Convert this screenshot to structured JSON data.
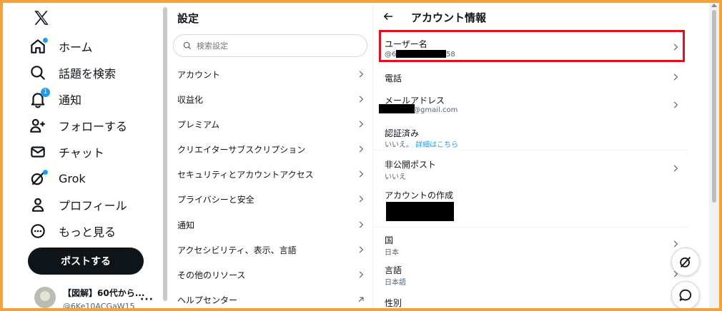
{
  "nav": {
    "items": [
      {
        "label": "ホーム",
        "icon": "home-icon"
      },
      {
        "label": "話題を検索",
        "icon": "search-icon"
      },
      {
        "label": "通知",
        "icon": "bell-icon",
        "badge": "1"
      },
      {
        "label": "フォローする",
        "icon": "follow-icon"
      },
      {
        "label": "チャット",
        "icon": "mail-icon"
      },
      {
        "label": "Grok",
        "icon": "grok-icon"
      },
      {
        "label": "プロフィール",
        "icon": "person-icon"
      },
      {
        "label": "もっと見る",
        "icon": "more-circle-icon"
      }
    ],
    "post_label": "ポストする",
    "account": {
      "name": "【図解】60代から...",
      "handle": "@6Ke10ACGaW15",
      "more": "···"
    }
  },
  "settings": {
    "title": "設定",
    "search_placeholder": "検索設定",
    "items": [
      {
        "label": "アカウント",
        "icon": "chevron-right-icon"
      },
      {
        "label": "収益化",
        "icon": "chevron-right-icon"
      },
      {
        "label": "プレミアム",
        "icon": "chevron-right-icon"
      },
      {
        "label": "クリエイターサブスクリプション",
        "icon": "chevron-right-icon"
      },
      {
        "label": "セキュリティとアカウントアクセス",
        "icon": "chevron-right-icon"
      },
      {
        "label": "プライバシーと安全",
        "icon": "chevron-right-icon"
      },
      {
        "label": "通知",
        "icon": "chevron-right-icon"
      },
      {
        "label": "アクセシビリティ、表示、言語",
        "icon": "chevron-right-icon"
      },
      {
        "label": "その他のリソース",
        "icon": "chevron-right-icon"
      },
      {
        "label": "ヘルプセンター",
        "icon": "external-link-icon"
      }
    ]
  },
  "account_info": {
    "title": "アカウント情報",
    "username": {
      "label": "ユーザー名",
      "value_prefix": "@6",
      "value_suffix": "58"
    },
    "phone": {
      "label": "電話"
    },
    "email": {
      "label": "メールアドレス",
      "value_suffix": "@gmail.com"
    },
    "verified": {
      "label": "認証済み",
      "value": "いいえ。",
      "link": "詳細はこちら"
    },
    "protected": {
      "label": "非公開ポスト",
      "value": "いいえ"
    },
    "created": {
      "label": "アカウントの作成"
    },
    "country": {
      "label": "国",
      "value": "日本"
    },
    "language": {
      "label": "言語",
      "value": "日本語"
    },
    "gender": {
      "label": "性別"
    }
  },
  "colors": {
    "accent": "#1d9bf0",
    "highlight": "#e0101e",
    "frame": "#f4a13a"
  }
}
